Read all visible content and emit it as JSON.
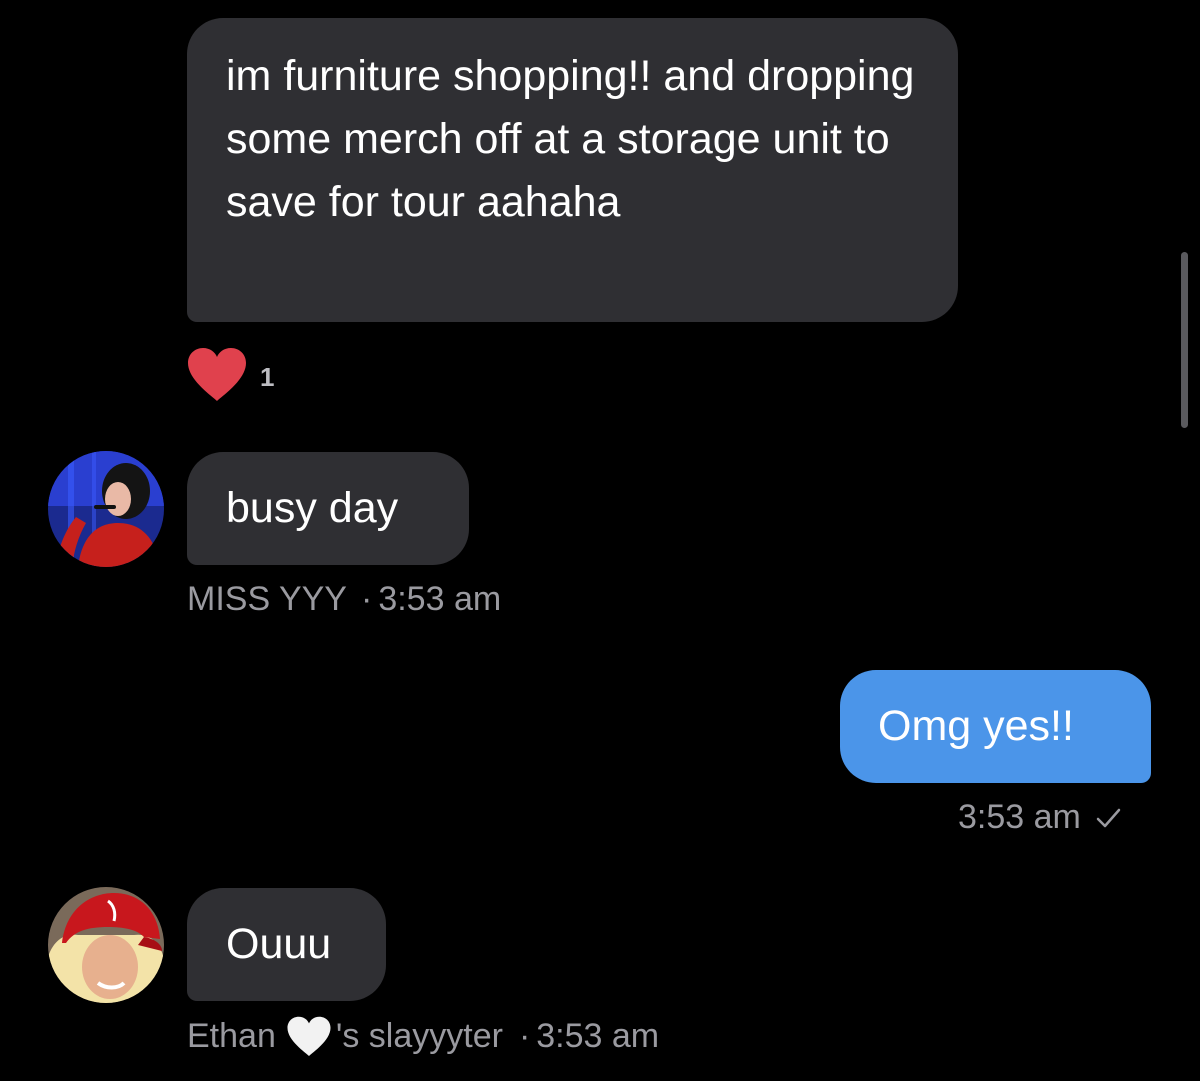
{
  "messages": [
    {
      "id": "msg1",
      "direction": "incoming",
      "text": "im furniture shopping!! and dropping some merch off at a storage unit to save for tour aahaha",
      "reaction": {
        "icon": "heart-icon",
        "count": "1",
        "color": "#e0414d"
      }
    },
    {
      "id": "msg2",
      "direction": "incoming",
      "text": "busy day",
      "sender": "MISS YYY",
      "separator": "·",
      "time": "3:53 am",
      "avatar": "avatar-miss-yyy"
    },
    {
      "id": "msg3",
      "direction": "outgoing",
      "text": "Omg yes!!",
      "time": "3:53 am",
      "status_icon": "check-icon"
    },
    {
      "id": "msg4",
      "direction": "incoming",
      "text": "Ouuu",
      "sender_prefix": "Ethan",
      "sender_heart_icon": "white-heart-icon",
      "sender_suffix": "'s slayyyter",
      "separator": "·",
      "time": "3:53 am",
      "avatar": "avatar-ethan"
    }
  ],
  "colors": {
    "background": "#000000",
    "incoming_bubble": "#2f2f33",
    "outgoing_bubble": "#4b95e9",
    "meta_text": "#9a9aa0",
    "reaction_heart": "#e0414d"
  }
}
